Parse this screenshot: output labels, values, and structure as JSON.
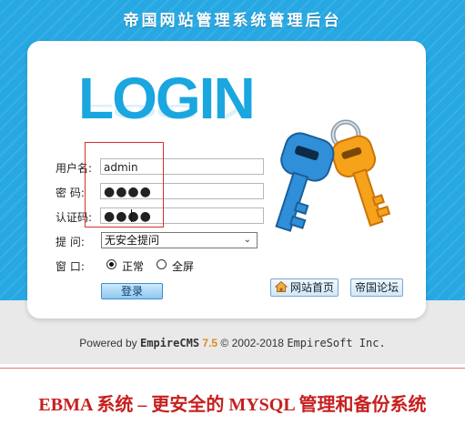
{
  "header": {
    "title": "帝国网站管理系统管理后台"
  },
  "logo": {
    "text": "LOGIN",
    "icon": "keys-icon"
  },
  "form": {
    "username_label": "用户名:",
    "username_value": "admin",
    "password_label": "密   码:",
    "password_value": "●●●●",
    "captcha_label": "认证码:",
    "captcha_value": "●●●●",
    "question_label": "提   问:",
    "question_selected": "无安全提问",
    "window_label": "窗   口:",
    "window_options": [
      "正常",
      "全屏"
    ],
    "window_selected": "正常",
    "login_button": "登录"
  },
  "links": {
    "home": "网站首页",
    "forum": "帝国论坛"
  },
  "footer": {
    "prefix": "Powered by",
    "brand": "EmpireCMS",
    "version": "7.5",
    "copyright": "© 2002-2018",
    "owner": "EmpireSoft Inc."
  },
  "banner": {
    "text": "EBMA 系统 – 更安全的 MYSQL 管理和备份系统"
  },
  "colors": {
    "accent": "#27a8e3",
    "banner_red": "#c6201f",
    "version_orange": "#e08a1e"
  }
}
